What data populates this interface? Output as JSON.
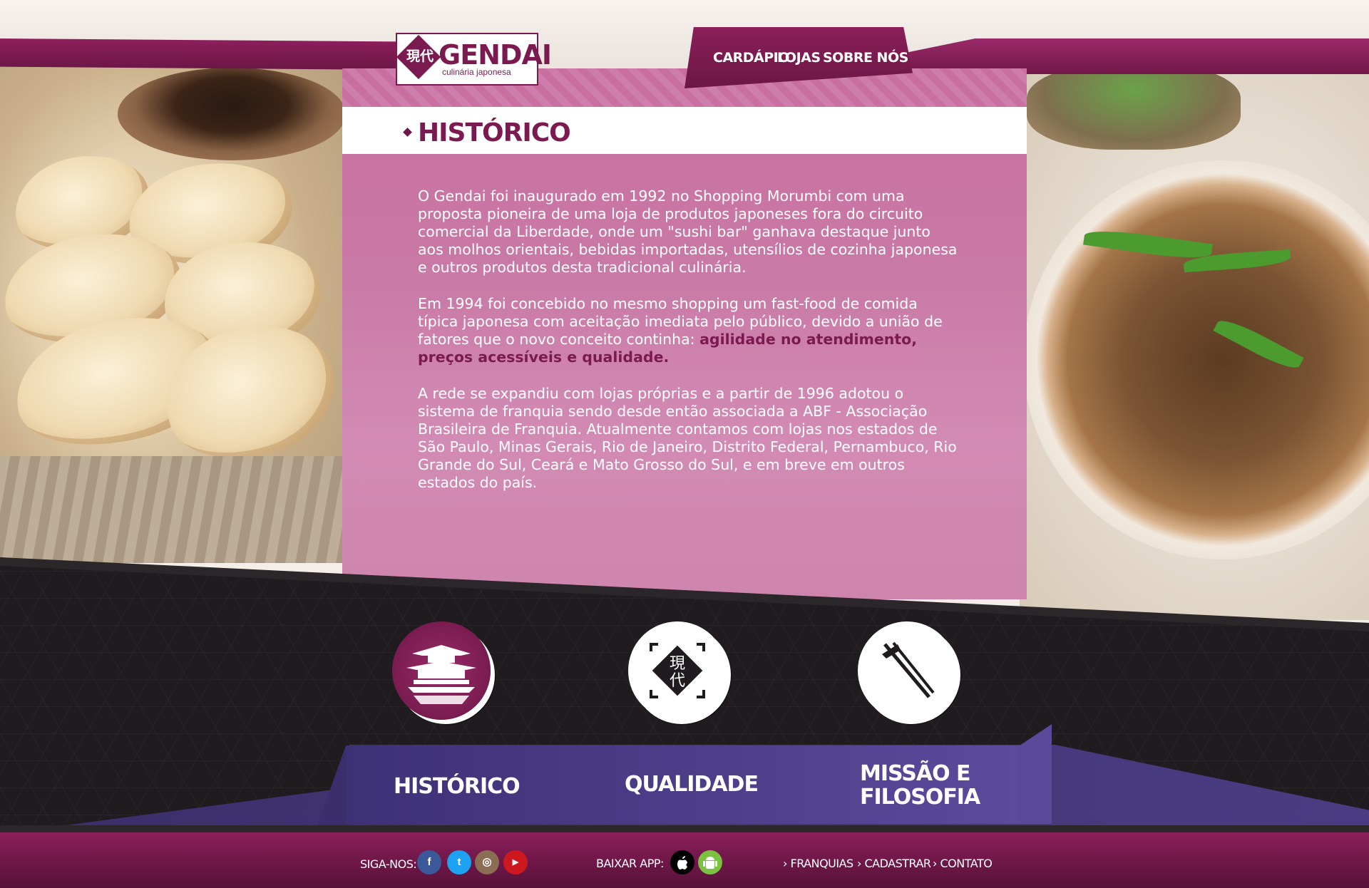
{
  "brand": {
    "name": "GENDAI",
    "tagline": "culinária japonesa",
    "mark": "現代"
  },
  "nav": [
    {
      "label": "CARDÁPIO"
    },
    {
      "label": "LOJAS"
    },
    {
      "label": "SOBRE NÓS"
    }
  ],
  "section": {
    "title": "HISTÓRICO",
    "p1": "O Gendai foi inaugurado em 1992 no Shopping Morumbi com uma proposta pioneira de uma loja de produtos japoneses fora do circuito comercial da Liberdade, onde um \"sushi bar\" ganhava destaque junto aos molhos orientais, bebidas importadas, utensílios de cozinha japonesa e outros produtos desta tradicional culinária.",
    "p2": "Em 1994 foi concebido no mesmo shopping um fast-food de comida típica japonesa com aceitação imediata pelo público, devido a união de fatores que o novo conceito continha: ",
    "p2_highlight": "agilidade no atendimento, preços acessíveis e qualidade.",
    "p3": "A rede se expandiu com lojas próprias e a partir de 1996 adotou o sistema de franquia sendo desde então associada a ABF - Associação Brasileira de Franquia. Atualmente contamos com lojas nos estados de São Paulo, Minas Gerais, Rio de Janeiro, Distrito Federal, Pernambuco, Rio Grande do Sul, Ceará e Mato Grosso do Sul, e em breve em outros estados do país."
  },
  "tabs": [
    {
      "label": "HISTÓRICO",
      "icon": "temple-icon"
    },
    {
      "label": "QUALIDADE",
      "icon": "gendai-mark-icon"
    },
    {
      "label_line1": "MISSÃO E",
      "label_line2": "FILOSOFIA",
      "icon": "chopsticks-icon"
    }
  ],
  "footer": {
    "follow_label": "SIGA-NOS:",
    "social": [
      {
        "name": "facebook-icon",
        "glyph": "f",
        "color": "#3b5998"
      },
      {
        "name": "twitter-icon",
        "glyph": "t",
        "color": "#1da1f2"
      },
      {
        "name": "instagram-icon",
        "glyph": "◎",
        "color": "#8a6d52"
      },
      {
        "name": "youtube-icon",
        "glyph": "▶",
        "color": "#cc181e"
      }
    ],
    "app_label": "BAIXAR APP:",
    "apps": [
      {
        "name": "apple-icon",
        "color": "#000000"
      },
      {
        "name": "android-icon",
        "color": "#7cc242"
      }
    ],
    "links": [
      {
        "label": "FRANQUIAS"
      },
      {
        "label": "CADASTRAR"
      },
      {
        "label": "CONTATO"
      }
    ]
  },
  "colors": {
    "brand": "#7b1a51",
    "panel": "#c97aa6",
    "tabs": "#4a3c82",
    "dark": "#1f1b1e"
  }
}
